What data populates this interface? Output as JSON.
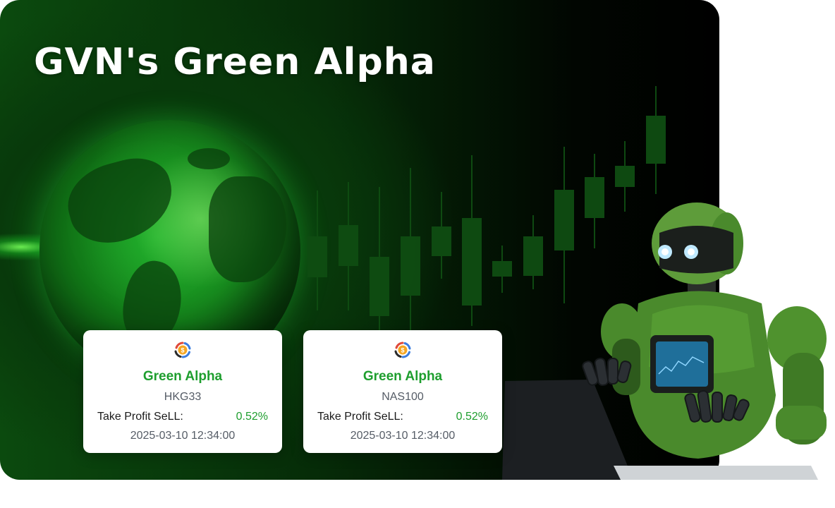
{
  "banner": {
    "title": "GVN's Green Alpha"
  },
  "cards": [
    {
      "name": "Green Alpha",
      "symbol": "HKG33",
      "label": "Take Profit SeLL:",
      "value": "0.52%",
      "time": "2025-03-10 12:34:00"
    },
    {
      "name": "Green Alpha",
      "symbol": "NAS100",
      "label": "Take Profit SeLL:",
      "value": "0.52%",
      "time": "2025-03-10 12:34:00"
    }
  ],
  "icons": {
    "card_logo": "dollar-coin-cycle-icon"
  },
  "colors": {
    "accent": "#1e9e2e",
    "background_dark": "#062b08"
  }
}
